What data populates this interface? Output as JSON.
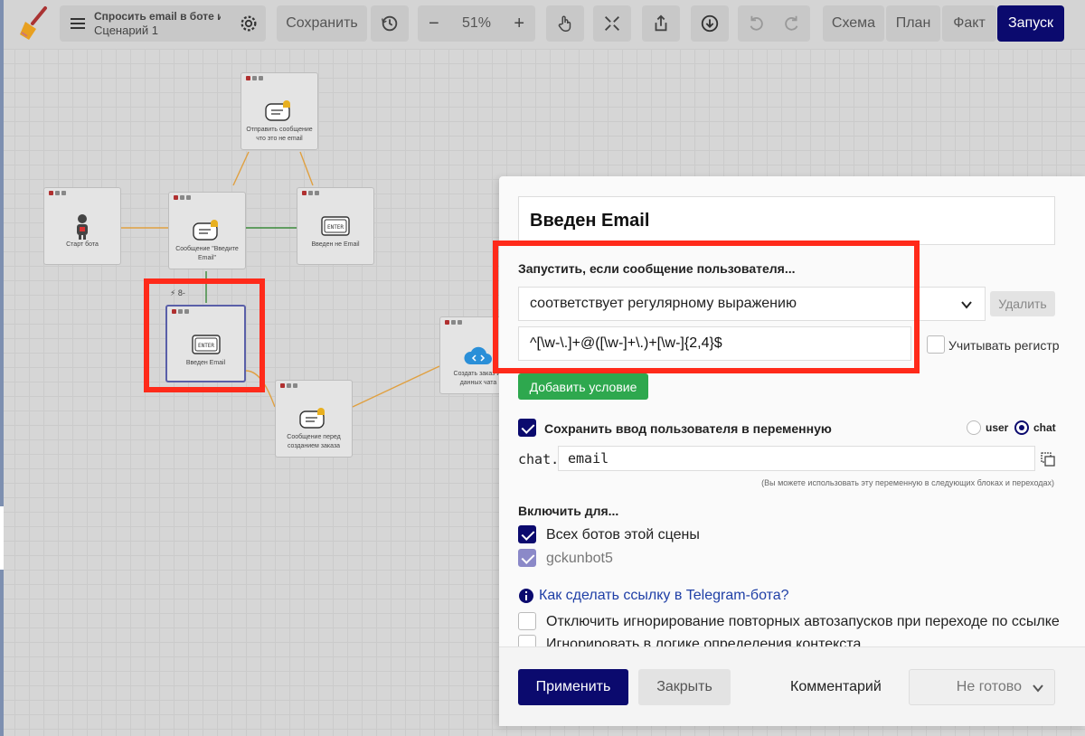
{
  "toolbar": {
    "title": "Спросить email в боте и с",
    "subtitle": "Сценарий 1",
    "save_label": "Сохранить",
    "zoom": "51%",
    "minus": "−",
    "plus": "+",
    "tabs": [
      "Схема",
      "План",
      "Факт"
    ],
    "launch_label": "Запуск"
  },
  "nodes": [
    {
      "id": "send-not-email",
      "label": "Отправить сообщение что это не email",
      "icon": "chat-bell-icon"
    },
    {
      "id": "bot-start",
      "label": "Старт бота",
      "icon": "robot-icon"
    },
    {
      "id": "enter-email-msg",
      "label": "Сообщение \"Введите Email\"",
      "icon": "chat-bell-icon"
    },
    {
      "id": "not-email-entered",
      "label": "Введен не Email",
      "icon": "enter-key-icon"
    },
    {
      "id": "email-entered",
      "label": "Введен Email",
      "icon": "enter-key-icon",
      "badge": "8-"
    },
    {
      "id": "create-order",
      "label": "Создать заказ из данных чата",
      "icon": "cloud-code-icon"
    },
    {
      "id": "msg-before-order",
      "label": "Сообщение перед созданием заказа",
      "icon": "chat-bell-icon"
    }
  ],
  "panel": {
    "name": "Введен Email",
    "trigger_label": "Запустить, если сообщение пользователя...",
    "condition": "соответствует регулярному выражению",
    "delete_label": "Удалить",
    "regex": "^[\\w-\\.]+@([\\w-]+\\.)+[\\w-]{2,4}$",
    "case_label": "Учитывать регистр",
    "add_condition_label": "Добавить условие",
    "save_input_label": "Сохранить ввод пользователя в переменную",
    "scope_user": "user",
    "scope_chat": "chat",
    "var_prefix": "chat.",
    "var_name": "email",
    "var_hint": "(Вы можете использовать эту переменную в следующих блоках и переходах)",
    "enable_for_label": "Включить для...",
    "all_bots_label": "Всех ботов этой сцены",
    "bot_name": "gckunbot5",
    "tg_link_label": "Как сделать ссылку в Telegram-бота?",
    "opt1": "Отключить игнорирование повторных автозапусков при переходе по ссылке",
    "opt2": "Игнорировать в логике определения контекста",
    "apply_label": "Применить",
    "close_label": "Закрыть",
    "comment_label": "Комментарий",
    "status_value": "Не готово"
  },
  "colors": {
    "primary": "#0b0a6e",
    "success": "#2ea84e",
    "highlight": "#ff2a1a",
    "link": "#1f3fa6"
  }
}
